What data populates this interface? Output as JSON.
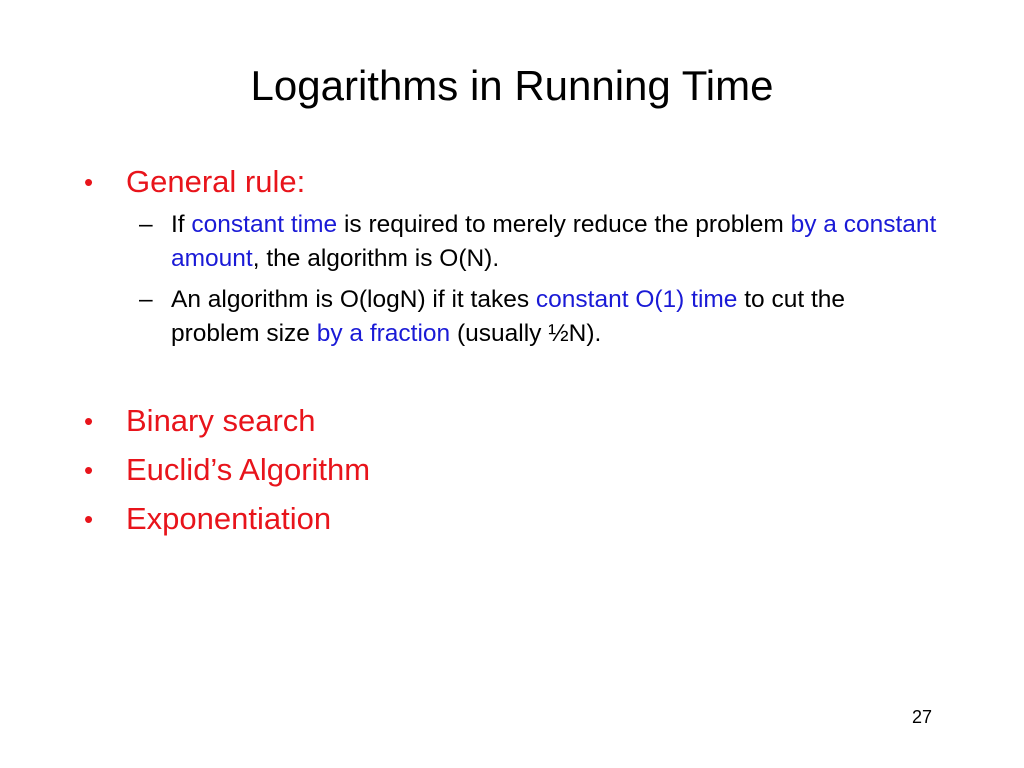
{
  "slide": {
    "title": "Logarithms in Running Time",
    "page_number": "27",
    "colors": {
      "bullet_red": "#e8141b",
      "highlight_blue": "#1a1ad6",
      "body_text": "#000000"
    },
    "bullet_glyph": "•",
    "dash_glyph": "–",
    "general_rule": {
      "label": "General rule:",
      "sub_points": [
        {
          "segments": [
            {
              "text": "If ",
              "highlight": false
            },
            {
              "text": "constant time",
              "highlight": true
            },
            {
              "text": " is required to merely reduce the problem ",
              "highlight": false
            },
            {
              "text": "by a constant amount",
              "highlight": true
            },
            {
              "text": ", the algorithm is O(N).",
              "highlight": false
            }
          ]
        },
        {
          "segments": [
            {
              "text": "An algorithm is O(logN) if it takes ",
              "highlight": false
            },
            {
              "text": "constant O(1) time",
              "highlight": true
            },
            {
              "text": " to cut the problem size ",
              "highlight": false
            },
            {
              "text": "by a fraction",
              "highlight": true
            },
            {
              "text": " (usually ½N).",
              "highlight": false
            }
          ]
        }
      ]
    },
    "examples": [
      {
        "label": "Binary search"
      },
      {
        "label": "Euclid’s Algorithm"
      },
      {
        "label": "Exponentiation"
      }
    ]
  }
}
